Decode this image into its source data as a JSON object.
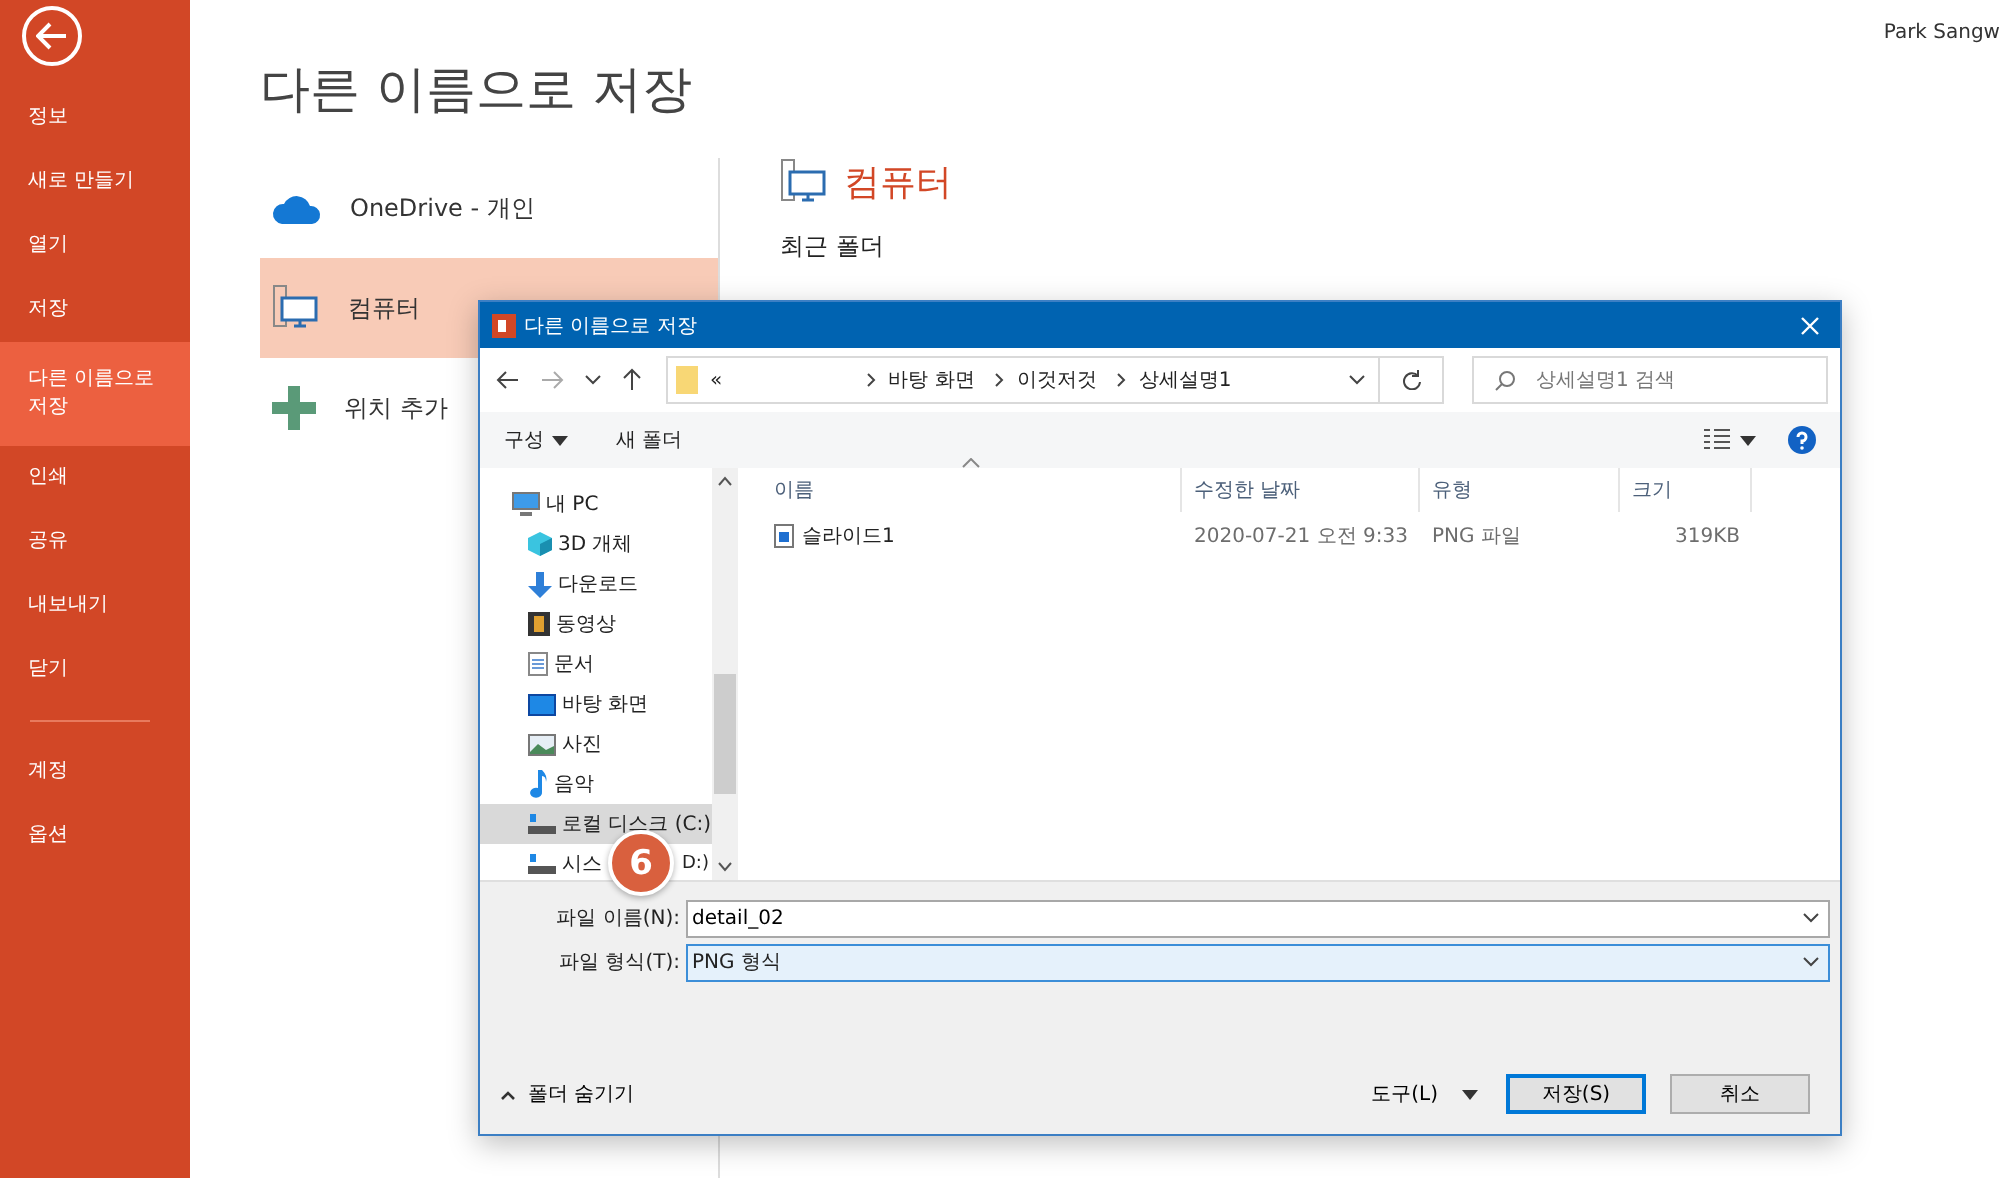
{
  "user": {
    "name": "Park Sangw"
  },
  "sidebar": {
    "items": [
      {
        "label": "정보",
        "selected": false
      },
      {
        "label": "새로 만들기",
        "selected": false
      },
      {
        "label": "열기",
        "selected": false
      },
      {
        "label": "저장",
        "selected": false
      },
      {
        "label": "다른 이름으로 저장",
        "selected": true
      },
      {
        "label": "인쇄",
        "selected": false
      },
      {
        "label": "공유",
        "selected": false
      },
      {
        "label": "내보내기",
        "selected": false
      },
      {
        "label": "닫기",
        "selected": false
      }
    ],
    "footer_items": [
      {
        "label": "계정",
        "selected": false
      },
      {
        "label": "옵션",
        "selected": false
      }
    ]
  },
  "page_title": "다른 이름으로 저장",
  "locations": [
    {
      "label": "OneDrive - 개인",
      "kind": "cloud",
      "selected": false
    },
    {
      "label": "컴퓨터",
      "kind": "computer",
      "selected": true
    },
    {
      "label": "위치 추가",
      "kind": "add",
      "selected": false
    }
  ],
  "detail": {
    "title": "컴퓨터",
    "section": "최근 폴더"
  },
  "dialog": {
    "title": "다른 이름으로 저장",
    "breadcrumb": [
      "«",
      "바탕 화면",
      "이것저것",
      "상세설명1"
    ],
    "search_placeholder": "상세설명1 검색",
    "toolbar": [
      "구성",
      "새 폴더"
    ],
    "tree": [
      {
        "label": "내 PC",
        "kind": "pc",
        "selected": false,
        "children": [
          {
            "label": "3D 개체",
            "kind": "cube",
            "selected": false
          },
          {
            "label": "다운로드",
            "kind": "download",
            "selected": false
          },
          {
            "label": "동영상",
            "kind": "video",
            "selected": false
          },
          {
            "label": "문서",
            "kind": "document",
            "selected": false
          },
          {
            "label": "바탕 화면",
            "kind": "desktop",
            "selected": false
          },
          {
            "label": "사진",
            "kind": "photo",
            "selected": false
          },
          {
            "label": "음악",
            "kind": "music",
            "selected": false
          },
          {
            "label": "로컬 디스크 (C:)",
            "kind": "drive",
            "selected": true
          },
          {
            "label": "시스",
            "label_tail": "D:)",
            "kind": "drive",
            "selected": false
          }
        ]
      }
    ],
    "columns": [
      "이름",
      "수정한 날짜",
      "유형",
      "크기"
    ],
    "rows": [
      {
        "name": "슬라이드1",
        "date": "2020-07-21 오전 9:33",
        "type": "PNG 파일",
        "size": "319KB"
      }
    ],
    "file_name": {
      "label": "파일 이름(N):",
      "value": "detail_02"
    },
    "file_type": {
      "label": "파일 형식(T):",
      "value": "PNG 형식"
    },
    "hide_folders": "폴더 숨기기",
    "tools": "도구(L)",
    "buttons": [
      "저장(S)",
      "취소"
    ]
  },
  "step_badge": "6"
}
